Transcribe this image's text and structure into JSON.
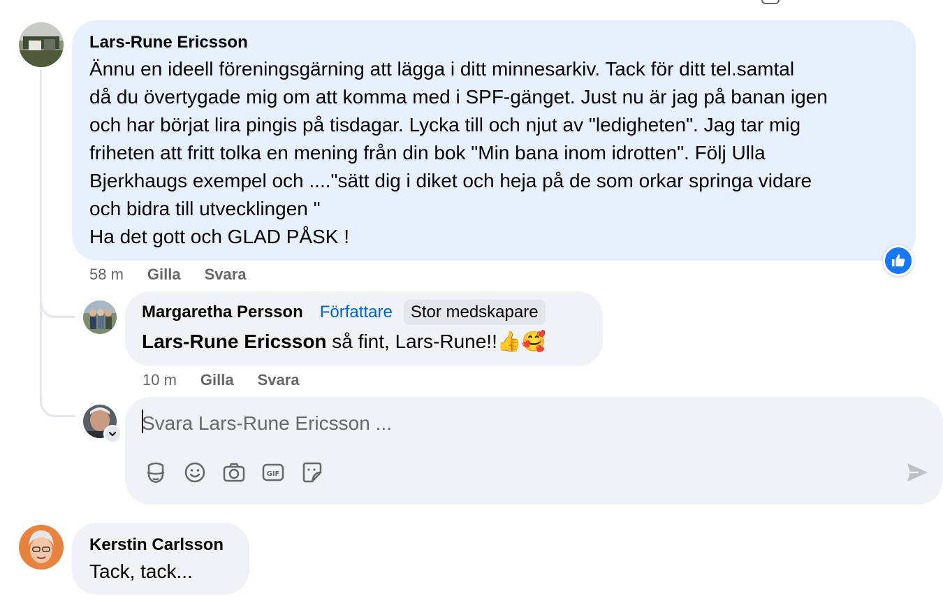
{
  "comments": [
    {
      "author": "Lars-Rune Ericsson",
      "lines": [
        "Ännu en ideell föreningsgärning att lägga i ditt minnesarkiv. Tack för ditt tel.samtal",
        "då du övertygade mig om att komma med i SPF-gänget. Just nu är jag på banan igen",
        "och har börjat lira pingis på tisdagar. Lycka till och njut av \"ledigheten\". Jag tar mig",
        "friheten att fritt tolka en mening från din bok \"Min bana inom idrotten\". Följ Ulla",
        "Bjerkhaugs exempel och ....\"sätt dig i diket och heja på de som orkar springa vidare",
        "och bidra till utvecklingen \"",
        "Ha det gott och GLAD PÅSK !"
      ],
      "time": "58 m",
      "like_label": "Gilla",
      "reply_label": "Svara",
      "reaction": "like-icon"
    },
    {
      "author": "Margaretha Persson",
      "author_tag": "Författare",
      "badge": "Stor medskapare",
      "mention": "Lars-Rune Ericsson",
      "text": " så fint, Lars-Rune!!",
      "emojis": "👍🥰",
      "time": "10 m",
      "like_label": "Gilla",
      "reply_label": "Svara"
    },
    {
      "author": "Kerstin Carlsson",
      "text": "Tack, tack..."
    }
  ],
  "reply_box": {
    "placeholder": "Svara Lars-Rune Ericsson ...",
    "icons": [
      "avatar-sticker-icon",
      "emoji-icon",
      "camera-icon",
      "gif-icon",
      "sticker-icon",
      "send-icon"
    ]
  },
  "colors": {
    "main_bubble": "#e7f1fd",
    "bubble": "#f0f2f5",
    "author_tag": "#0064d1",
    "like_badge": "#1877f2",
    "meta": "#65676b"
  }
}
